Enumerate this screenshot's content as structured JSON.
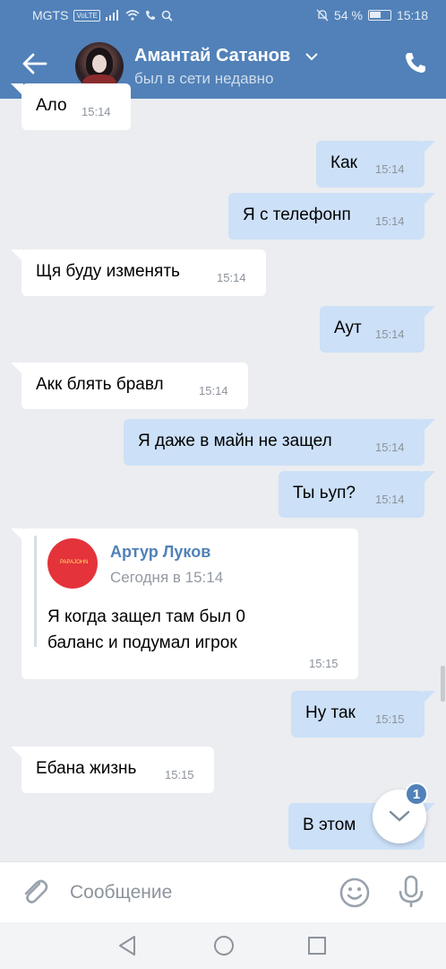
{
  "status_bar": {
    "carrier": "MGTS",
    "volte": "VoLTE",
    "battery": "54 %",
    "time": "15:18"
  },
  "header": {
    "contact_name": "Амантай Сатанов",
    "contact_status": "был в сети недавно",
    "accent_color": "#5181b8"
  },
  "messages": [
    {
      "dir": "in",
      "text": "Ало",
      "time": "15:14"
    },
    {
      "dir": "out",
      "text": "Как",
      "time": "15:14"
    },
    {
      "dir": "out",
      "text": "Я с телефонп",
      "time": "15:14"
    },
    {
      "dir": "in",
      "text": "Щя буду изменять",
      "time": "15:14"
    },
    {
      "dir": "out",
      "text": "Аут",
      "time": "15:14"
    },
    {
      "dir": "in",
      "text": "Акк блять бравл",
      "time": "15:14"
    },
    {
      "dir": "out",
      "text": "Я даже в майн не защел",
      "time": "15:14"
    },
    {
      "dir": "out",
      "text": "Ты ьуп?",
      "time": "15:14"
    },
    {
      "dir": "out",
      "text": "Ну так",
      "time": "15:15"
    },
    {
      "dir": "in",
      "text": "Ебана жизнь",
      "time": "15:15"
    },
    {
      "dir": "out",
      "text": "В этом",
      "time": ""
    }
  ],
  "forwarded": {
    "author": "Артур Луков",
    "date": "Сегодня в 15:14",
    "line1": "Я когда защел там был 0",
    "line2": "баланс и подумал игрок",
    "time": "15:15",
    "avatar_color": "#e4333a"
  },
  "scroll_down": {
    "badge_count": "1"
  },
  "composer": {
    "placeholder": "Сообщение"
  }
}
